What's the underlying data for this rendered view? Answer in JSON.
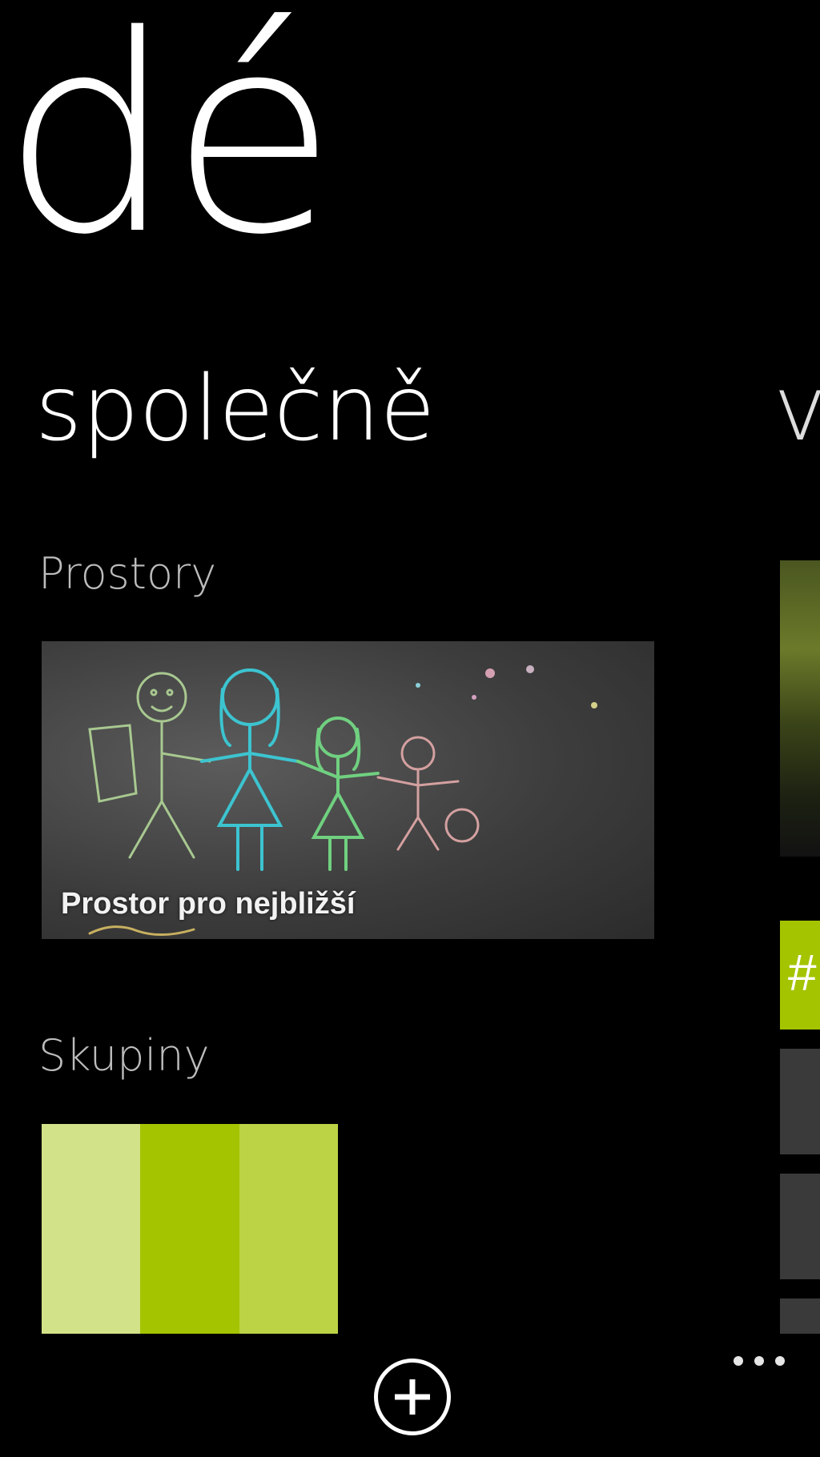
{
  "hub": {
    "title": "dé"
  },
  "pivot": {
    "current": "společně",
    "next": "v"
  },
  "rooms": {
    "label": "Prostory",
    "items": [
      {
        "name": "Prostor pro nejbližší"
      }
    ]
  },
  "groups": {
    "label": "Skupiny",
    "tile_colors": [
      "#d2e288",
      "#a4c400",
      "#bcd345"
    ]
  },
  "right_panel": {
    "accent_color": "#a4c400",
    "accent_glyph": "#"
  },
  "app_bar": {
    "add_icon": "plus-circle-icon",
    "more_icon": "ellipsis-icon"
  }
}
